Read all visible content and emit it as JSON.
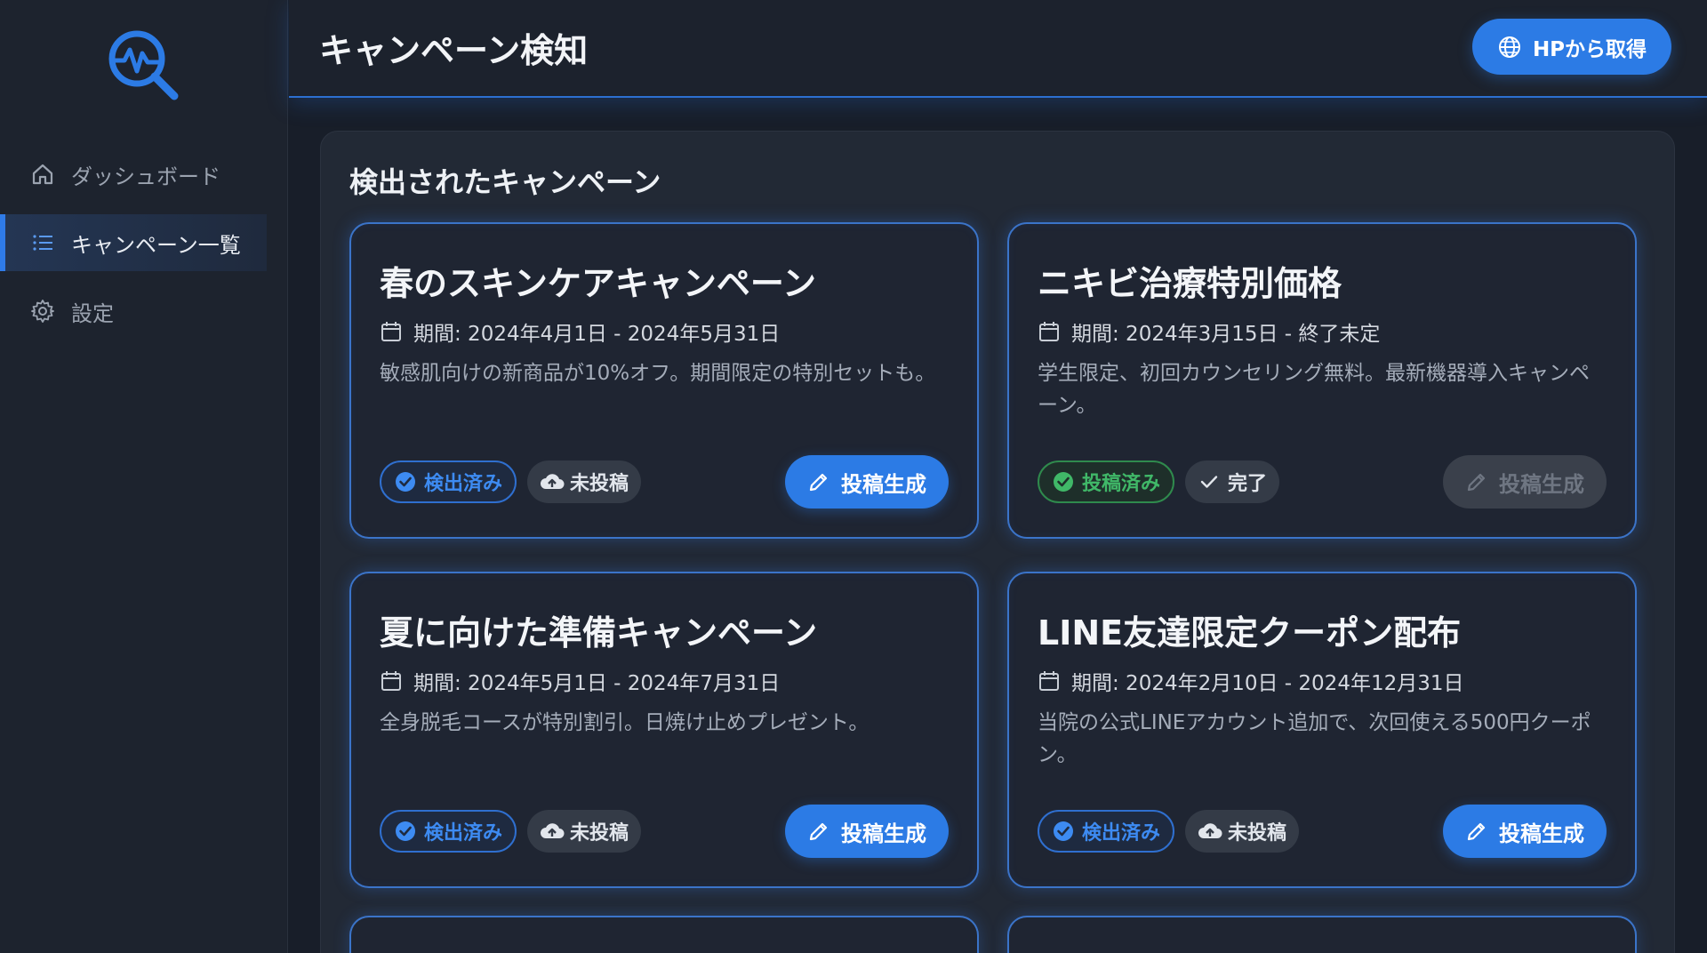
{
  "header": {
    "title": "キャンペーン検知",
    "hp_button_label": "HPから取得"
  },
  "sidebar": {
    "items": [
      {
        "label": "ダッシュボード",
        "icon": "home-icon",
        "active": false
      },
      {
        "label": "キャンペーン一覧",
        "icon": "list-icon",
        "active": true
      },
      {
        "label": "設定",
        "icon": "gear-icon",
        "active": false
      }
    ]
  },
  "main": {
    "section_title": "検出されたキャンペーン",
    "campaigns": [
      {
        "title": "春のスキンケアキャンペーン",
        "period": "期間: 2024年4月1日 - 2024年5月31日",
        "description": "敏感肌向けの新商品が10%オフ。期間限定の特別セットも。",
        "status_tag": "検出済み",
        "post_tag": "未投稿",
        "button": "投稿生成"
      },
      {
        "title": "ニキビ治療特別価格",
        "period": "期間: 2024年3月15日 - 終了未定",
        "description": "学生限定、初回カウンセリング無料。最新機器導入キャンペーン。",
        "status_tag": "投稿済み",
        "post_tag": "完了",
        "button": "投稿生成"
      },
      {
        "title": "夏に向けた準備キャンペーン",
        "period": "期間: 2024年5月1日 - 2024年7月31日",
        "description": "全身脱毛コースが特別割引。日焼け止めプレゼント。",
        "status_tag": "検出済み",
        "post_tag": "未投稿",
        "button": "投稿生成"
      },
      {
        "title": "LINE友達限定クーポン配布",
        "period": "期間: 2024年2月10日 - 2024年12月31日",
        "description": "当院の公式LINEアカウント追加で、次回使える500円クーポン。",
        "status_tag": "検出済み",
        "post_tag": "未投稿",
        "button": "投稿生成"
      }
    ]
  },
  "colors": {
    "accent": "#2c7be5",
    "success": "#40b868",
    "background": "#181e29"
  }
}
